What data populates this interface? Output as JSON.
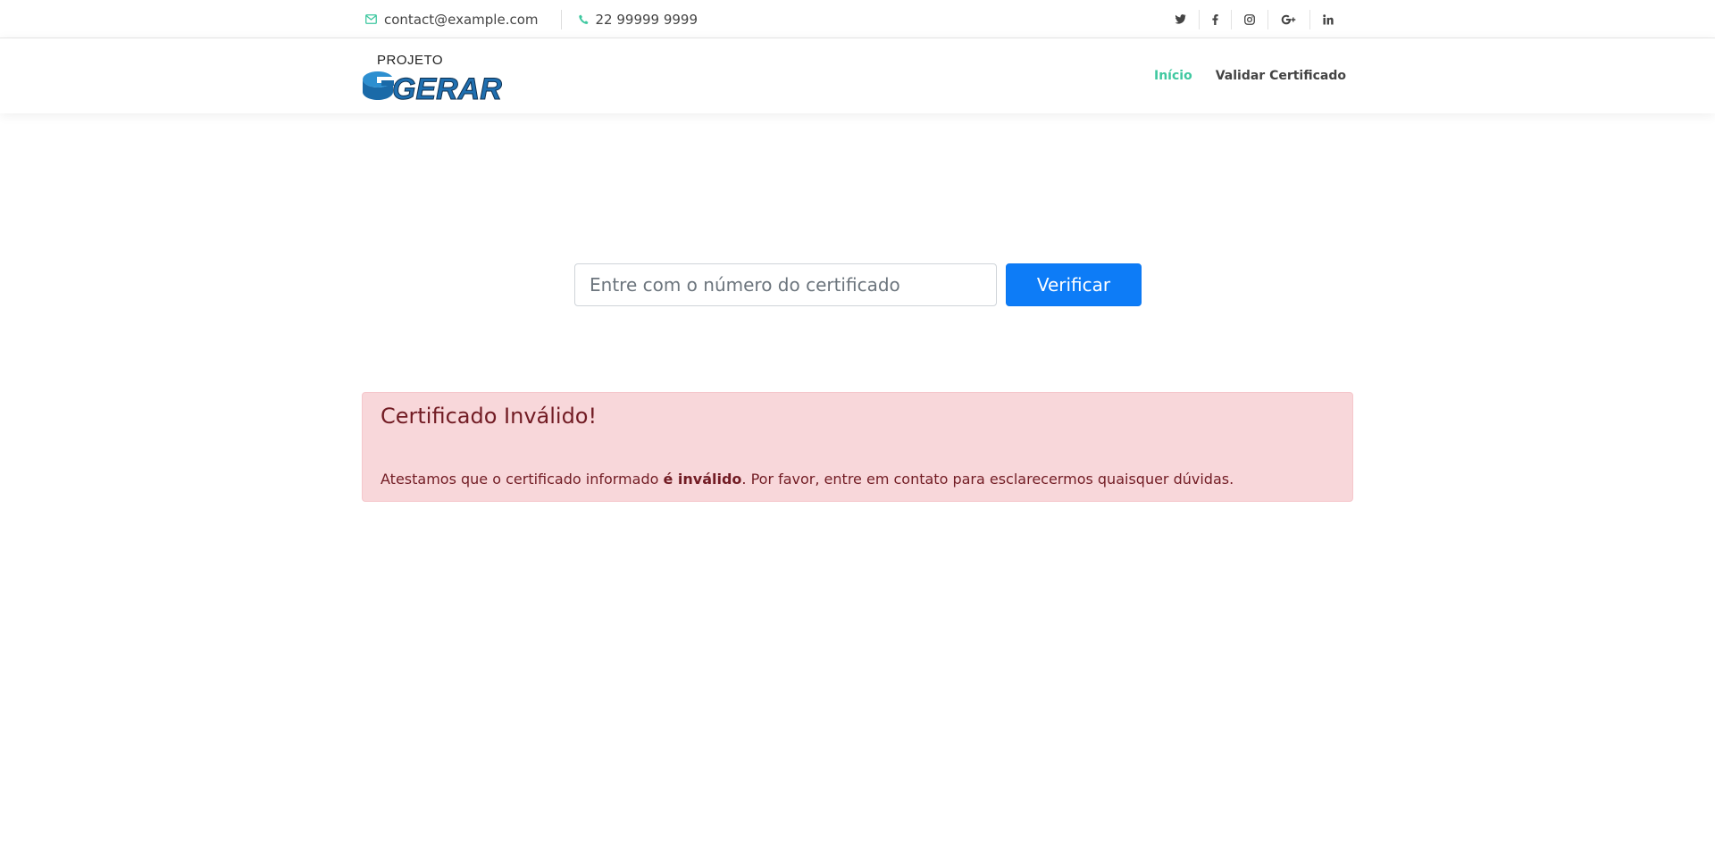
{
  "topbar": {
    "email": "contact@example.com",
    "phone": "22 99999 9999",
    "social": [
      {
        "icon": "twitter-icon",
        "label": "twitter"
      },
      {
        "icon": "facebook-icon",
        "label": "facebook"
      },
      {
        "icon": "instagram-icon",
        "label": "instagram"
      },
      {
        "icon": "google-plus-icon",
        "label": "google-plus"
      },
      {
        "icon": "linkedin-icon",
        "label": "linkedin"
      }
    ]
  },
  "logo": {
    "top_text": "PROJETO",
    "main_text": "GERAR"
  },
  "nav": {
    "items": [
      {
        "label": "Início",
        "active": true
      },
      {
        "label": "Validar Certificado",
        "active": false
      }
    ]
  },
  "search": {
    "placeholder": "Entre com o número do certificado",
    "value": "",
    "button_label": "Verificar"
  },
  "alert": {
    "title": "Certificado Inválido!",
    "message_prefix": "Atestamos que o certificado informado ",
    "message_bold": "é inválido",
    "message_suffix": ". Por favor, entre em contato para esclarecermos quaisquer dúvidas."
  },
  "colors": {
    "accent": "#3fc8a0",
    "primary_button": "#0d7cf7",
    "alert_bg": "#f8d7da",
    "alert_text": "#721c24",
    "logo_blue": "#1f6fb0"
  }
}
